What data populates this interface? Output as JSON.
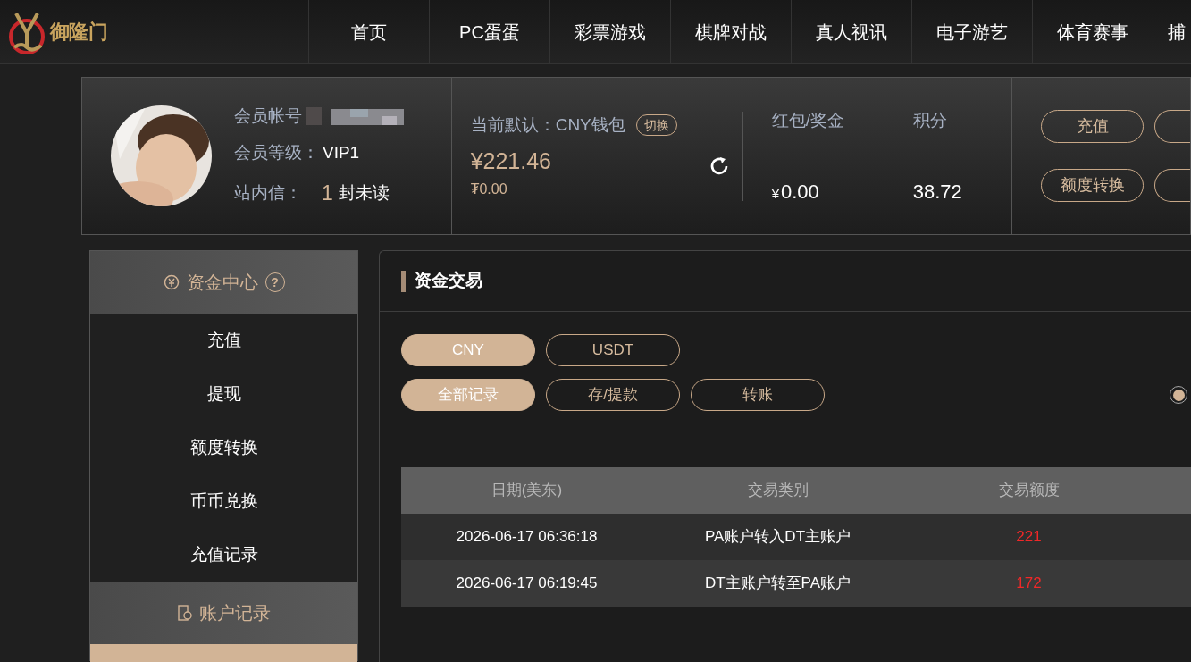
{
  "brand": {
    "name": "御隆门"
  },
  "nav": [
    {
      "label": "首页"
    },
    {
      "label": "PC蛋蛋"
    },
    {
      "label": "彩票游戏"
    },
    {
      "label": "棋牌对战"
    },
    {
      "label": "真人视讯"
    },
    {
      "label": "电子游艺"
    },
    {
      "label": "体育赛事"
    },
    {
      "label": "捕"
    }
  ],
  "profile": {
    "account_label": "会员帐号",
    "level_label": "会员等级：",
    "level": "VIP1",
    "message_label": "站内信：",
    "unread_count": "1",
    "unread_text": "封未读"
  },
  "wallet": {
    "default_label": "当前默认：CNY钱包",
    "switch": "切换",
    "balance": "¥221.46",
    "sub_balance": "₮0.00",
    "bonus_label": "红包/奖金",
    "bonus_currency": "¥",
    "bonus": "0.00",
    "points_label": "积分",
    "points": "38.72"
  },
  "actions": [
    "充值",
    "额度转换"
  ],
  "sidebar": {
    "sections": [
      {
        "title": "资金中心",
        "kind": "funds",
        "help_mark": "?",
        "items": [
          {
            "label": "充值"
          },
          {
            "label": "提现"
          },
          {
            "label": "额度转换"
          },
          {
            "label": "币币兑换"
          },
          {
            "label": "充值记录"
          }
        ]
      },
      {
        "title": "账户记录",
        "kind": "records",
        "items": [
          {
            "selected": true
          }
        ]
      }
    ]
  },
  "panel": {
    "title": "资金交易",
    "currencies": [
      {
        "label": "CNY",
        "selected": true
      },
      {
        "label": "USDT",
        "selected": false
      }
    ],
    "filters": [
      {
        "label": "全部记录",
        "selected": true
      },
      {
        "label": "存/提款",
        "selected": false
      },
      {
        "label": "转账",
        "selected": false
      }
    ],
    "radio": {
      "selected": true
    },
    "table": {
      "columns": [
        "日期(美东)",
        "交易类别",
        "交易额度"
      ],
      "rows": [
        [
          "2026-06-17 06:36:18",
          "PA账户转入DT主账户",
          "221"
        ],
        [
          "2026-06-17 06:19:45",
          "DT主账户转至PA账户",
          "172"
        ]
      ]
    }
  }
}
